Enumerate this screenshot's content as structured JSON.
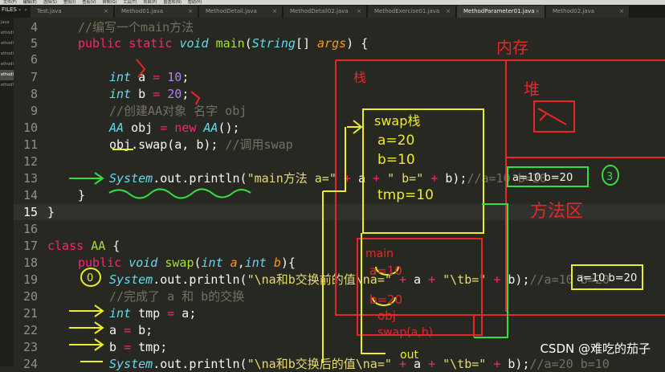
{
  "menubar": [
    "文件(F)",
    "编辑(E)",
    "选择(S)",
    "查找(I)",
    "查看(V)",
    "转到(G)",
    "工具(T)",
    "项目(P)",
    "首选项(N)",
    "帮助(H)"
  ],
  "sidebar": {
    "label": "FILES",
    "items": [
      "Java",
      "ethodl",
      "ethodl",
      "ethodl",
      "ethodl",
      "ethodl",
      "ethodl"
    ]
  },
  "tabs": [
    {
      "label": "Test.java"
    },
    {
      "label": "Method01.java"
    },
    {
      "label": "MethodDetail.java"
    },
    {
      "label": "MethodDetail02.java"
    },
    {
      "label": "MethodExercise01.java"
    },
    {
      "label": "MethodParameter01.java"
    },
    {
      "label": "Method02.java"
    }
  ],
  "active_tab": "MethodParameter01.java",
  "line_numbers": [
    "4",
    "5",
    "6",
    "7",
    "8",
    "9",
    "10",
    "11",
    "12",
    "13",
    "14",
    "15",
    "16",
    "17",
    "18",
    "19",
    "20",
    "21",
    "22",
    "23",
    "24"
  ],
  "code": {
    "l4": "//编写一个main方法",
    "l9": "//创建AA对象 名字 obj",
    "l11_comment": "//调用swap",
    "l13_str": "\"main方法 a=\"",
    "l13_str2": "\" b=\"",
    "l13_comment": "//a=10 b=20",
    "l19_str": "\"\\na和b交换前的值\\na=\"",
    "l19_str2": "\"\\tb=\"",
    "l19_comment": "//a=10 b=20",
    "l20": "//完成了 a 和 b的交换",
    "l24_str": "\"\\na和b交换后的值\\na=\"",
    "l24_str2": "\"\\tb=\"",
    "l24_comment": "//a=20 b=10"
  },
  "annotations": {
    "memory": "内存",
    "stack": "栈",
    "heap": "堆",
    "method_area": "方法区",
    "swap_stack": "swap栈",
    "swap_a": "a=20",
    "swap_b": "b=10",
    "swap_tmp": "tmp=10",
    "main_label": "main",
    "main_a": "a=10",
    "main_b": "b=20",
    "main_obj": "obj",
    "swap_call": "swap(a,b)",
    "out_label": "out",
    "step_0": "0",
    "step_3": "3",
    "result_box": "a=10 b=20"
  },
  "watermark": "CSDN @难吃的茄子"
}
